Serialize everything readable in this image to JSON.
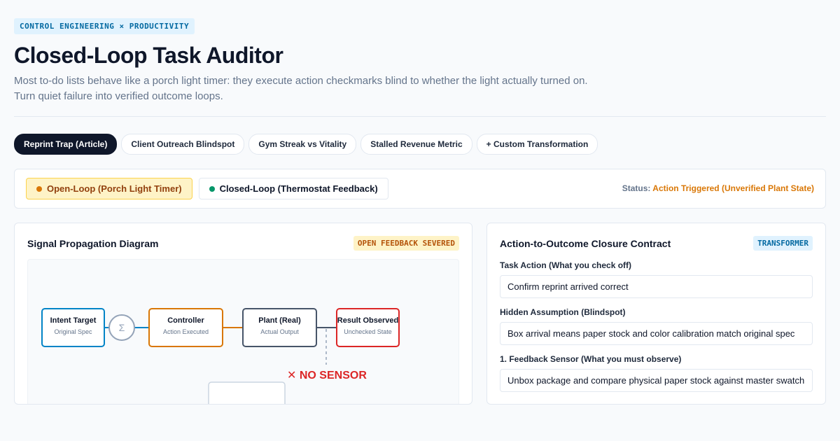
{
  "header": {
    "kicker": "CONTROL ENGINEERING × PRODUCTIVITY",
    "title": "Closed-Loop Task Auditor",
    "subtitle": "Most to-do lists behave like a porch light timer: they execute action checkmarks blind to whether the light actually turned on. Turn quiet failure into verified outcome loops."
  },
  "tabs": [
    {
      "label": "Reprint Trap (Article)",
      "active": true
    },
    {
      "label": "Client Outreach Blindspot",
      "active": false
    },
    {
      "label": "Gym Streak vs Vitality",
      "active": false
    },
    {
      "label": "Stalled Revenue Metric",
      "active": false
    },
    {
      "label": "+ Custom Transformation",
      "active": false
    }
  ],
  "modes": {
    "open": {
      "label": "Open-Loop (Porch Light Timer)",
      "dot_color": "#d97706"
    },
    "closed": {
      "label": "Closed-Loop (Thermostat Feedback)",
      "dot_color": "#059669"
    },
    "status_label": "Status:",
    "status_value": "Action Triggered (Unverified Plant State)"
  },
  "diagram": {
    "title": "Signal Propagation Diagram",
    "badge": "OPEN FEEDBACK SEVERED",
    "nodes": {
      "intent": {
        "title": "Intent Target",
        "sub": "Original Spec",
        "color": "#0284c7"
      },
      "sum": {
        "symbol": "Σ",
        "color": "#94a3b8"
      },
      "controller": {
        "title": "Controller",
        "sub": "Action Executed",
        "color": "#d97706"
      },
      "plant": {
        "title": "Plant (Real)",
        "sub": "Actual Output",
        "color": "#475569"
      },
      "result": {
        "title": "Result Observed",
        "sub": "Unchecked State",
        "color": "#dc2626"
      }
    },
    "no_sensor": "✕ NO SENSOR"
  },
  "contract": {
    "title": "Action-to-Outcome Closure Contract",
    "badge": "TRANSFORMER",
    "task_action": {
      "label": "Task Action (What you check off)",
      "value": "Confirm reprint arrived correct"
    },
    "hidden_assumption": {
      "label": "Hidden Assumption (Blindspot)",
      "value": "Box arrival means paper stock and color calibration match original spec"
    },
    "feedback_sensor": {
      "label": "1. Feedback Sensor (What you must observe)",
      "value": "Unbox package and compare physical paper stock against master swatch"
    }
  }
}
